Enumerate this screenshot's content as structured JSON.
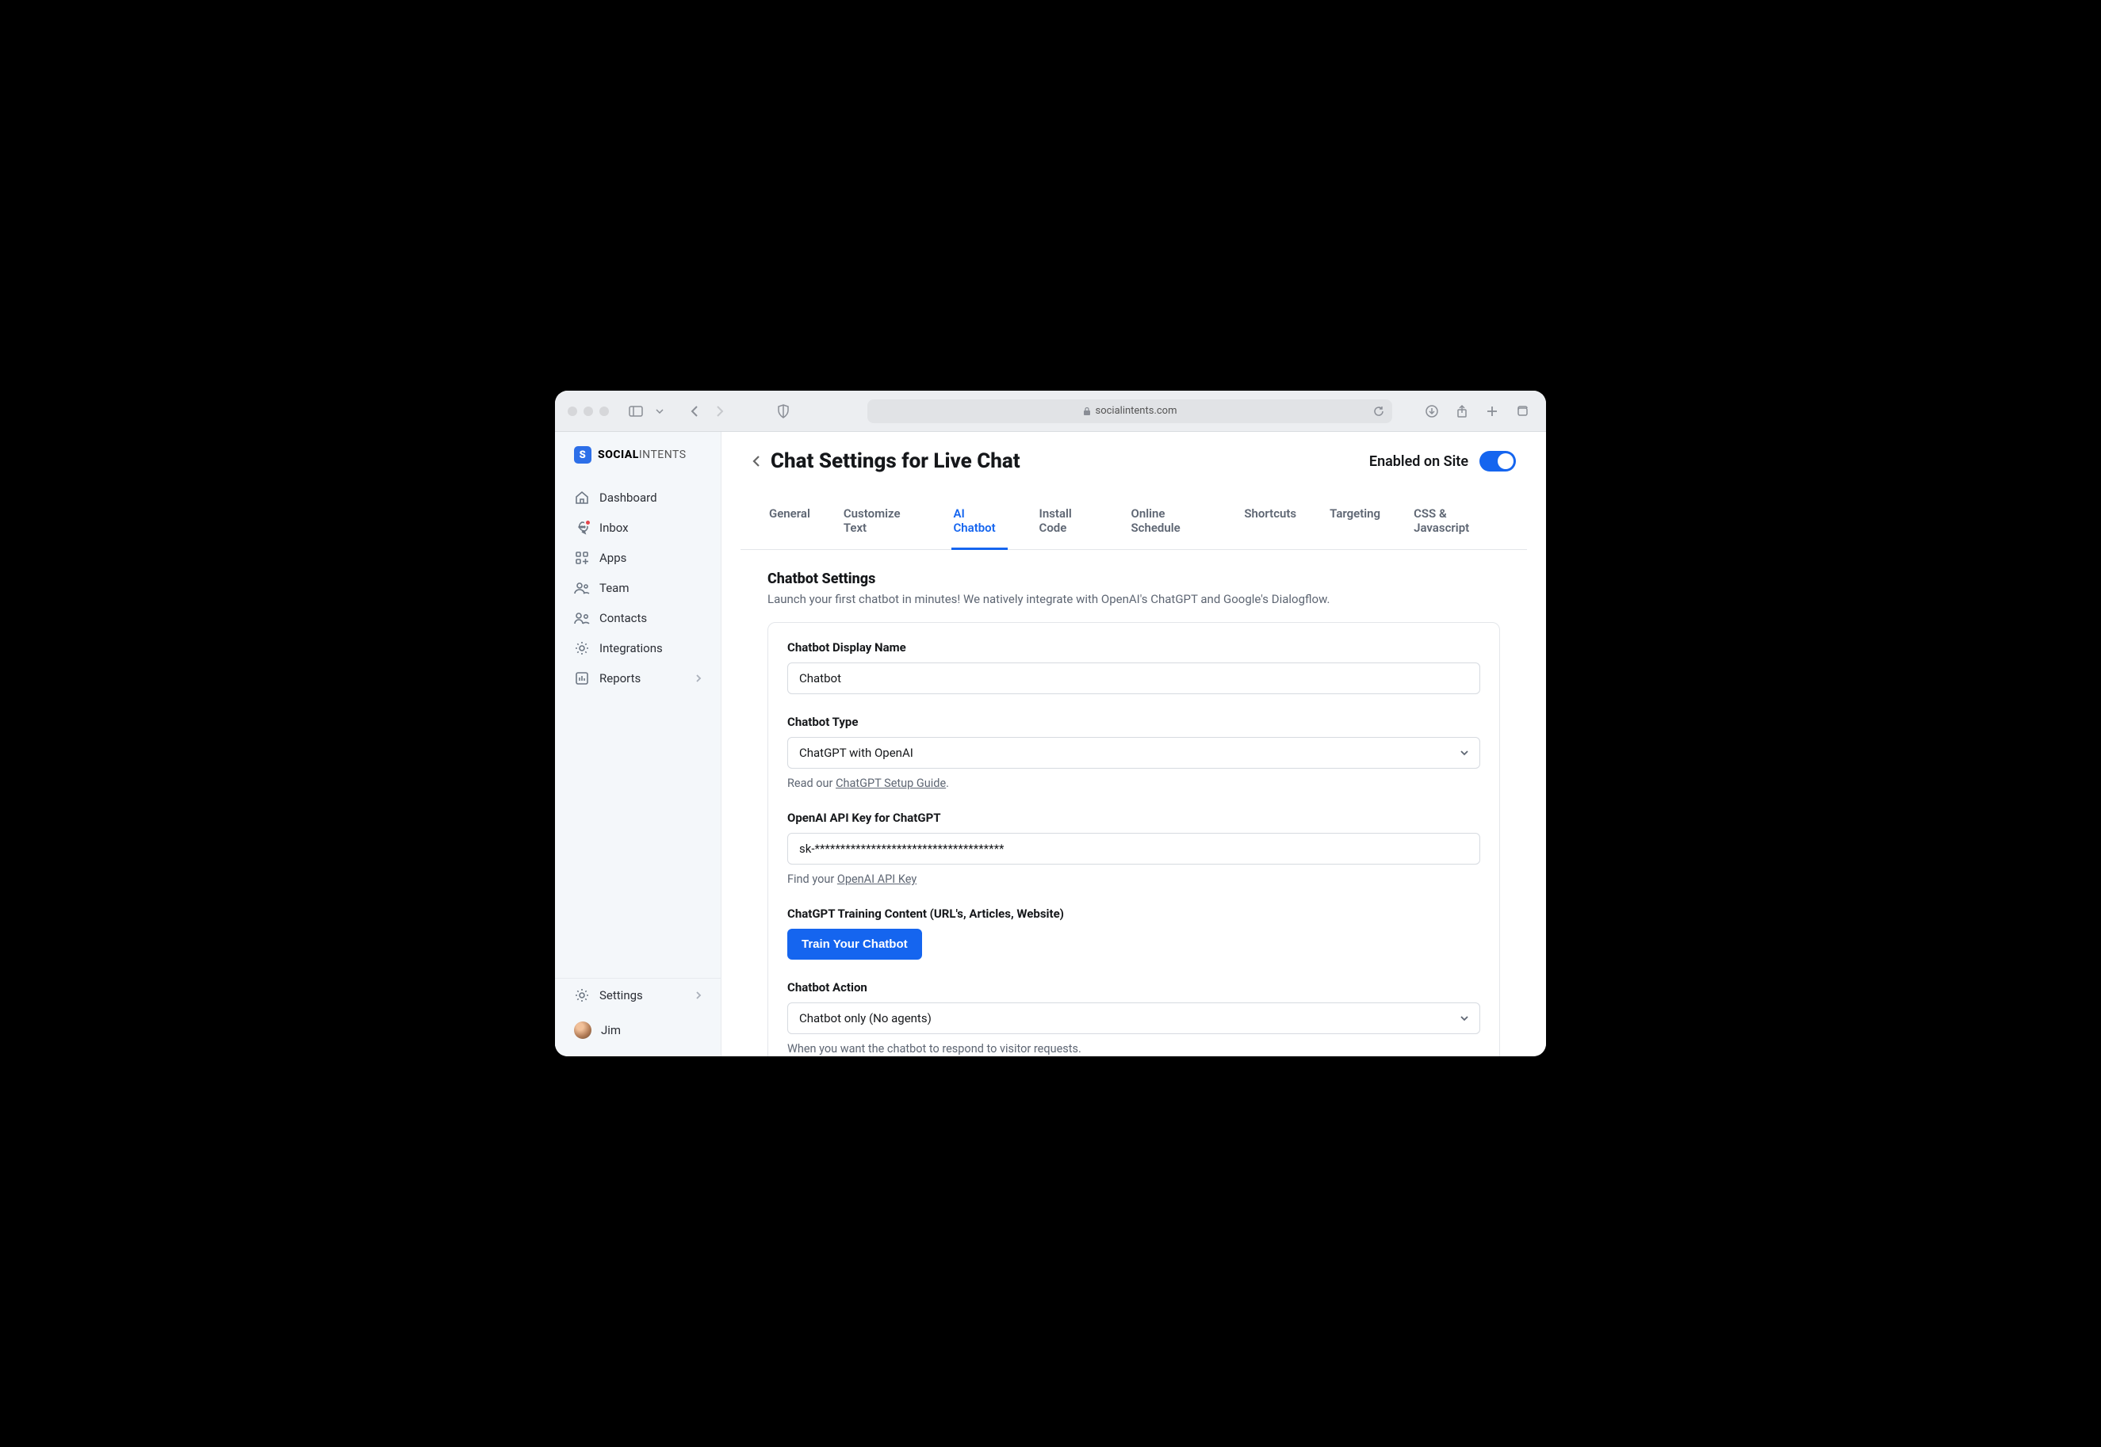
{
  "browser": {
    "url": "socialintents.com"
  },
  "logo": {
    "bold": "SOCIAL",
    "thin": "INTENTS"
  },
  "sidebar": {
    "items": [
      {
        "label": "Dashboard"
      },
      {
        "label": "Inbox"
      },
      {
        "label": "Apps"
      },
      {
        "label": "Team"
      },
      {
        "label": "Contacts"
      },
      {
        "label": "Integrations"
      },
      {
        "label": "Reports"
      }
    ],
    "bottom": {
      "settings": "Settings",
      "user": "Jim"
    }
  },
  "header": {
    "title": "Chat Settings for Live Chat",
    "enabled_label": "Enabled on Site"
  },
  "tabs": [
    "General",
    "Customize Text",
    "AI Chatbot",
    "Install Code",
    "Online Schedule",
    "Shortcuts",
    "Targeting",
    "CSS & Javascript"
  ],
  "active_tab": "AI Chatbot",
  "section": {
    "title": "Chatbot Settings",
    "desc": "Launch your first chatbot in minutes! We natively integrate with OpenAI's ChatGPT and Google's Dialogflow."
  },
  "form": {
    "display_name": {
      "label": "Chatbot Display Name",
      "value": "Chatbot"
    },
    "type": {
      "label": "Chatbot Type",
      "value": "ChatGPT with OpenAI",
      "helper_prefix": "Read our ",
      "helper_link": "ChatGPT Setup Guide",
      "helper_suffix": "."
    },
    "api_key": {
      "label": "OpenAI API Key for ChatGPT",
      "value": "sk-*************************************",
      "helper_prefix": "Find your ",
      "helper_link": "OpenAI API Key"
    },
    "training": {
      "label": "ChatGPT Training Content (URL's, Articles, Website)",
      "button": "Train Your Chatbot"
    },
    "action": {
      "label": "Chatbot Action",
      "value": "Chatbot only (No agents)",
      "helper": "When you want the chatbot to respond to visitor requests."
    }
  }
}
